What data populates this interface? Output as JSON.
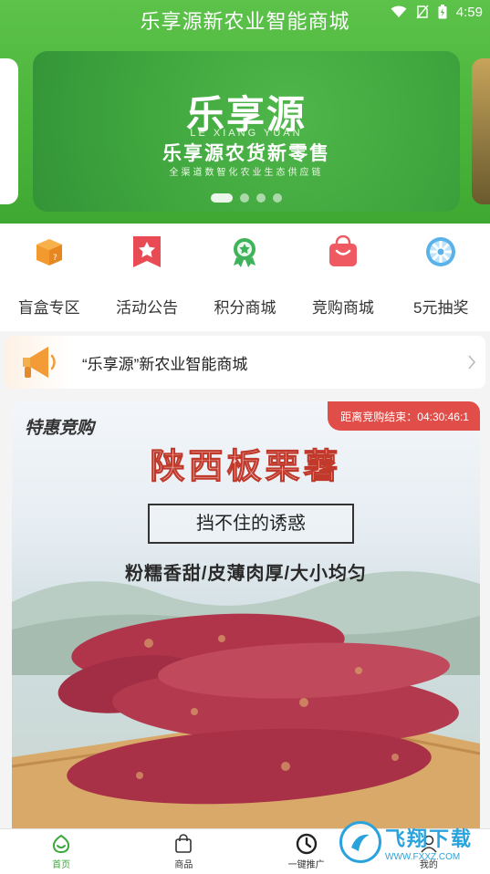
{
  "status_bar": {
    "time": "4:59"
  },
  "app_title": "乐享源新农业智能商城",
  "banner": {
    "logo_text": "乐享源",
    "logo_en": "LE XIANG YUAN",
    "slogan": "乐享源农货新零售",
    "slogan_sub": "全渠道数智化农业生态供应链",
    "slide_count": 4,
    "active_slide": 1
  },
  "nav": [
    {
      "label": "盲盒专区",
      "icon": "gift-box-icon",
      "color": "#f39a2e"
    },
    {
      "label": "活动公告",
      "icon": "star-bookmark-icon",
      "color": "#e94b54"
    },
    {
      "label": "积分商城",
      "icon": "medal-icon",
      "color": "#3fb35a"
    },
    {
      "label": "竞购商城",
      "icon": "shopping-bag-icon",
      "color": "#ef5a62"
    },
    {
      "label": "5元抽奖",
      "icon": "prize-wheel-icon",
      "color": "#5ab2e8"
    }
  ],
  "notice": {
    "text": "“乐享源”新农业智能商城"
  },
  "auction": {
    "tag": "特惠竞购",
    "countdown": "距离竞购结束：04:30:46:1",
    "product_title": "陕西板栗薯",
    "boxed_text": "挡不住的诱惑",
    "features": "粉糯香甜/皮薄肉厚/大小均匀"
  },
  "tabs": [
    {
      "label": "首页",
      "icon": "home-icon",
      "active": true
    },
    {
      "label": "商品",
      "icon": "bag-icon",
      "active": false
    },
    {
      "label": "一键推广",
      "icon": "clock-icon",
      "active": false
    },
    {
      "label": "我的",
      "icon": "user-icon",
      "active": false
    }
  ],
  "watermark": {
    "cn": "飞翔下载",
    "url": "WWW.FXXZ.COM"
  },
  "colors": {
    "brand_green": "#4cb83c",
    "accent_red": "#e14d48"
  }
}
